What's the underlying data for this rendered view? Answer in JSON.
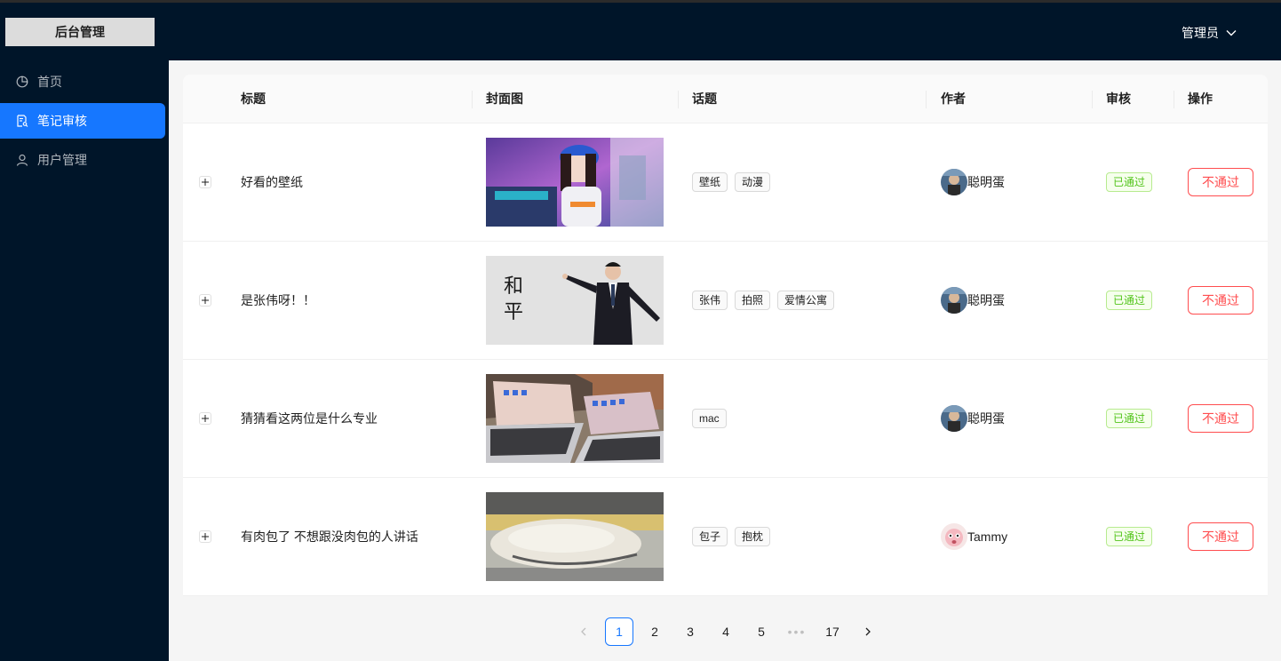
{
  "app": {
    "logo_text": "后台管理"
  },
  "sidebar": {
    "items": [
      {
        "label": "首页",
        "icon": "pie-chart-icon",
        "active": false
      },
      {
        "label": "笔记审核",
        "icon": "file-search-icon",
        "active": true
      },
      {
        "label": "用户管理",
        "icon": "user-icon",
        "active": false
      }
    ]
  },
  "header": {
    "user_label": "管理员",
    "dropdown_icon": "chevron-down-icon"
  },
  "table": {
    "columns": [
      "标题",
      "封面图",
      "话题",
      "作者",
      "审核",
      "操作"
    ],
    "rows": [
      {
        "title": "好看的壁纸",
        "cover": "girl-gaming-room",
        "tags": [
          "壁纸",
          "动漫"
        ],
        "author": "聪明蛋",
        "status": "已通过",
        "action": "不通过"
      },
      {
        "title": "是张伟呀！！",
        "cover": "man-in-suit",
        "cover_text": [
          "和",
          "平"
        ],
        "tags": [
          "张伟",
          "拍照",
          "爱情公寓"
        ],
        "author": "聪明蛋",
        "status": "已通过",
        "action": "不通过"
      },
      {
        "title": "猜猜看这两位是什么专业",
        "cover": "two-laptops",
        "tags": [
          "mac"
        ],
        "author": "聪明蛋",
        "status": "已通过",
        "action": "不通过"
      },
      {
        "title": "有肉包了 不想跟没肉包的人讲话",
        "cover": "bun-pillow",
        "tags": [
          "包子",
          "抱枕"
        ],
        "author": "Tammy",
        "status": "已通过",
        "action": "不通过"
      }
    ]
  },
  "pagination": {
    "prev_icon": "chevron-left-icon",
    "pages": [
      "1",
      "2",
      "3",
      "4",
      "5"
    ],
    "ellipsis": "•••",
    "last": "17",
    "next_icon": "chevron-right-icon",
    "current": "1"
  },
  "colors": {
    "sidebar_bg": "#001529",
    "accent": "#1677ff",
    "success": "#52c41a",
    "danger": "#ff4d4f"
  }
}
